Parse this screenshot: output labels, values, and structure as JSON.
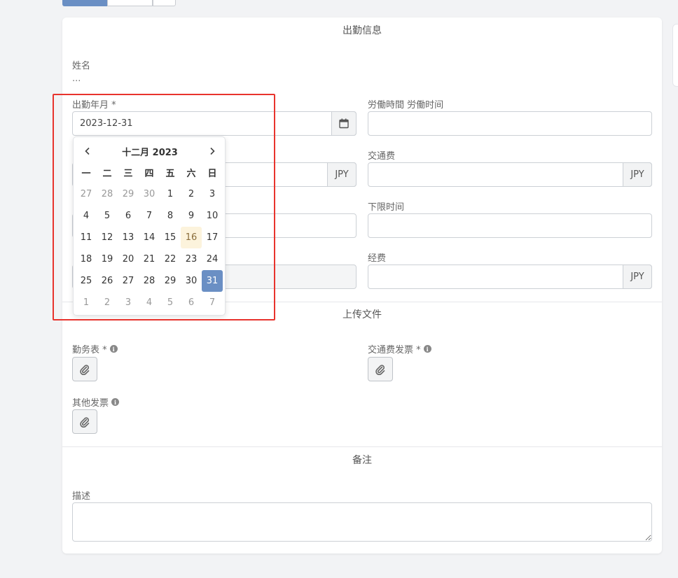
{
  "sections": {
    "attendance": "出勤信息",
    "upload": "上传文件",
    "remarks": "备注"
  },
  "fields": {
    "name_label": "姓名",
    "name_value": "...",
    "month_label": "出勤年月 *",
    "month_value": "2023-12-31",
    "work_time_label": "労働時間 労働时间",
    "transport_label": "交通费",
    "lower_limit_label": "下限时间",
    "expense_label": "经费",
    "currency": "JPY"
  },
  "uploads": {
    "timesheet_label": "勤务表 *",
    "transport_invoice_label": "交通费发票 *",
    "other_invoice_label": "其他发票",
    "info_glyph": "i"
  },
  "remarks": {
    "desc_label": "描述"
  },
  "datepicker": {
    "title": "十二月 2023",
    "weekdays": [
      "一",
      "二",
      "三",
      "四",
      "五",
      "六",
      "日"
    ],
    "weeks": [
      [
        {
          "d": "27",
          "m": true
        },
        {
          "d": "28",
          "m": true
        },
        {
          "d": "29",
          "m": true
        },
        {
          "d": "30",
          "m": true
        },
        {
          "d": "1"
        },
        {
          "d": "2"
        },
        {
          "d": "3"
        }
      ],
      [
        {
          "d": "4"
        },
        {
          "d": "5"
        },
        {
          "d": "6"
        },
        {
          "d": "7"
        },
        {
          "d": "8"
        },
        {
          "d": "9"
        },
        {
          "d": "10"
        }
      ],
      [
        {
          "d": "11"
        },
        {
          "d": "12"
        },
        {
          "d": "13"
        },
        {
          "d": "14"
        },
        {
          "d": "15"
        },
        {
          "d": "16",
          "today": true
        },
        {
          "d": "17"
        }
      ],
      [
        {
          "d": "18"
        },
        {
          "d": "19"
        },
        {
          "d": "20"
        },
        {
          "d": "21"
        },
        {
          "d": "22"
        },
        {
          "d": "23"
        },
        {
          "d": "24"
        }
      ],
      [
        {
          "d": "25"
        },
        {
          "d": "26"
        },
        {
          "d": "27"
        },
        {
          "d": "28"
        },
        {
          "d": "29"
        },
        {
          "d": "30"
        },
        {
          "d": "31",
          "sel": true
        }
      ],
      [
        {
          "d": "1",
          "m": true
        },
        {
          "d": "2",
          "m": true
        },
        {
          "d": "3",
          "m": true
        },
        {
          "d": "4",
          "m": true
        },
        {
          "d": "5",
          "m": true
        },
        {
          "d": "6",
          "m": true
        },
        {
          "d": "7",
          "m": true
        }
      ]
    ]
  },
  "colors": {
    "accent": "#6a8fc4",
    "today_bg": "#fcf3dc",
    "highlight": "#e8332d"
  }
}
